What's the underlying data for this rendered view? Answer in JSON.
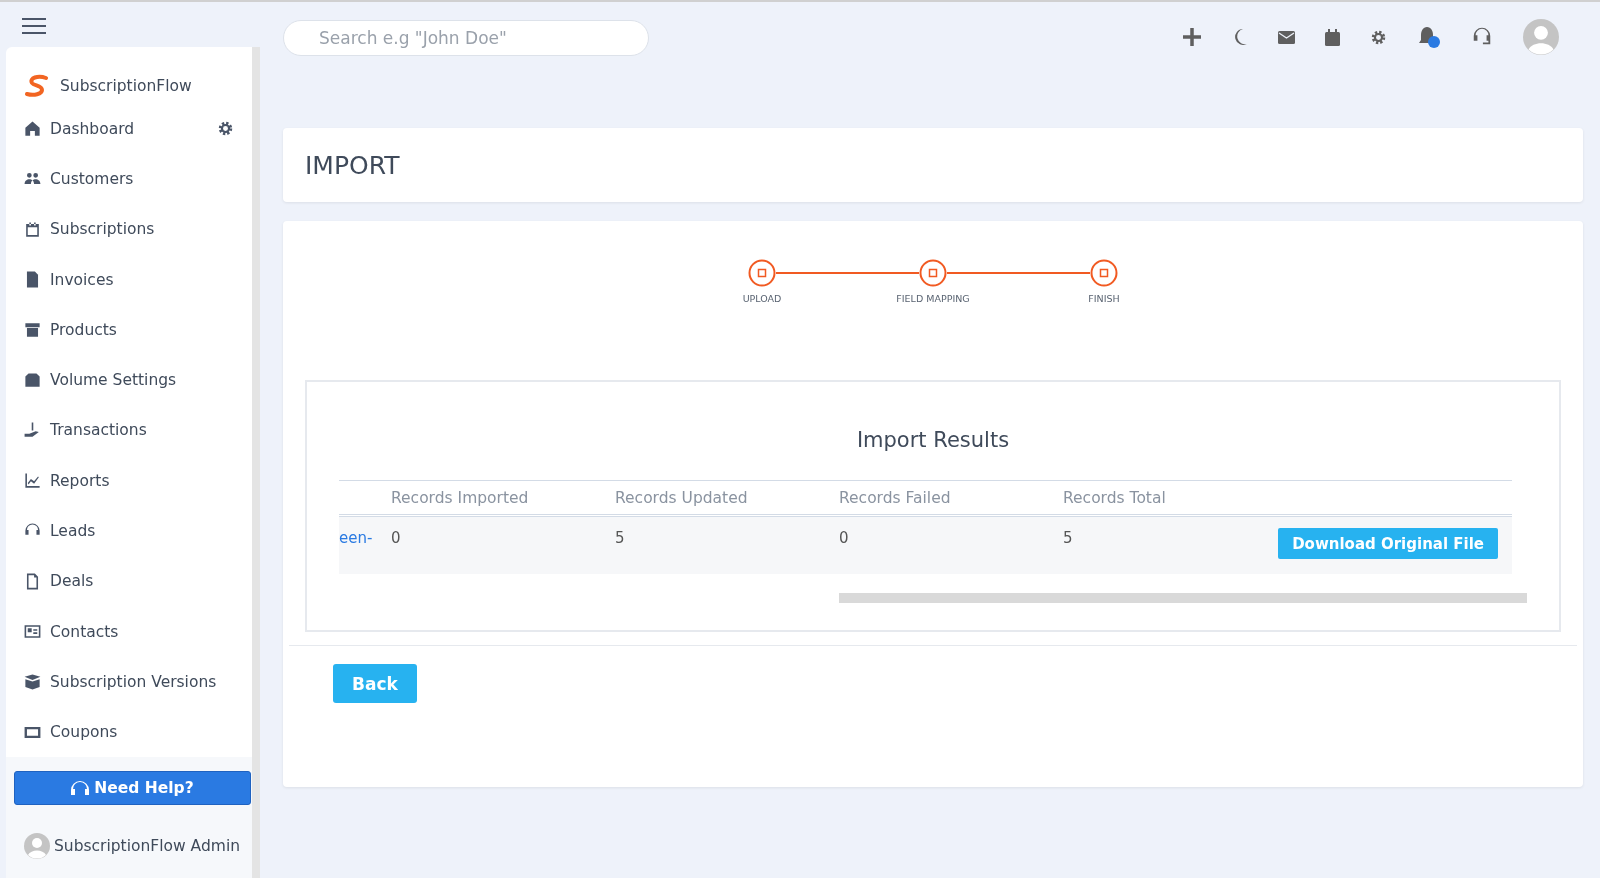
{
  "header": {
    "search": {
      "placeholder": "Search e.g \"John Doe\""
    },
    "notification_badge": true
  },
  "sidebar": {
    "brand": "SubscriptionFlow",
    "items": [
      {
        "label": "Dashboard",
        "settings": true
      },
      {
        "label": "Customers",
        "settings": false
      },
      {
        "label": "Subscriptions",
        "settings": false
      },
      {
        "label": "Invoices",
        "settings": false
      },
      {
        "label": "Products",
        "settings": false
      },
      {
        "label": "Volume Settings",
        "settings": false
      },
      {
        "label": "Transactions",
        "settings": false
      },
      {
        "label": "Reports",
        "settings": false
      },
      {
        "label": "Leads",
        "settings": false
      },
      {
        "label": "Deals",
        "settings": false
      },
      {
        "label": "Contacts",
        "settings": false
      },
      {
        "label": "Subscription Versions",
        "settings": false
      },
      {
        "label": "Coupons",
        "settings": false
      }
    ],
    "help_button": "Need Help?",
    "user": "SubscriptionFlow Admin"
  },
  "page_title": "IMPORT",
  "steps": [
    {
      "label": "UPLOAD",
      "done": true
    },
    {
      "label": "FIELD MAPPING",
      "done": true
    },
    {
      "label": "FINISH",
      "done": true
    }
  ],
  "results": {
    "title": "Import Results",
    "columns": [
      "",
      "Records Imported",
      "Records Updated",
      "Records Failed",
      "Records Total"
    ],
    "rows": [
      {
        "cells": [
          "een-",
          "0",
          "5",
          "0",
          "5"
        ],
        "action": "Download Original File"
      }
    ]
  },
  "back_button": "Back"
}
